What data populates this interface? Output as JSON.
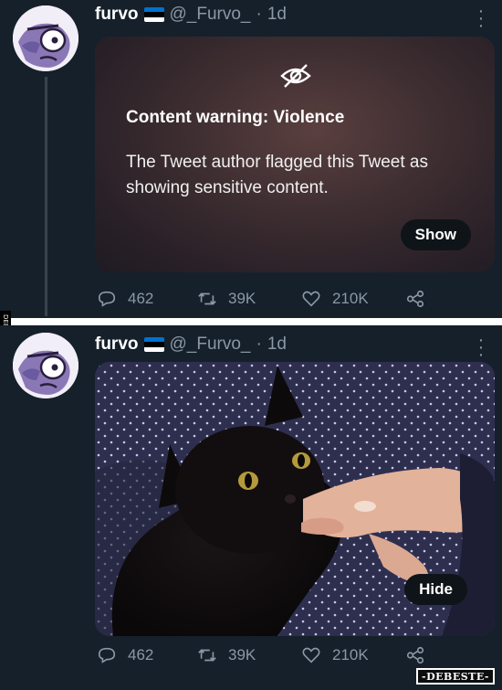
{
  "tweets": [
    {
      "author": {
        "name": "furvo",
        "handle": "@_Furvo_",
        "time": "1d"
      },
      "content_warning": {
        "title": "Content warning: Violence",
        "text": "The Tweet author flagged this Tweet as showing sensitive content.",
        "button": "Show"
      },
      "stats": {
        "replies": "462",
        "retweets": "39K",
        "likes": "210K"
      }
    },
    {
      "author": {
        "name": "furvo",
        "handle": "@_Furvo_",
        "time": "1d"
      },
      "media": {
        "button": "Hide"
      },
      "stats": {
        "replies": "462",
        "retweets": "39K",
        "likes": "210K"
      }
    }
  ],
  "flag_colors": [
    "#0072ce",
    "#000000",
    "#ffffff"
  ],
  "watermark": "-DEBESTE-",
  "side_watermark": "DEBESTE",
  "colors": {
    "background": "#15202b",
    "muted": "#8b98a5"
  },
  "icons": [
    "eye-off-icon",
    "reply-icon",
    "retweet-icon",
    "like-icon",
    "share-icon",
    "more-icon"
  ]
}
